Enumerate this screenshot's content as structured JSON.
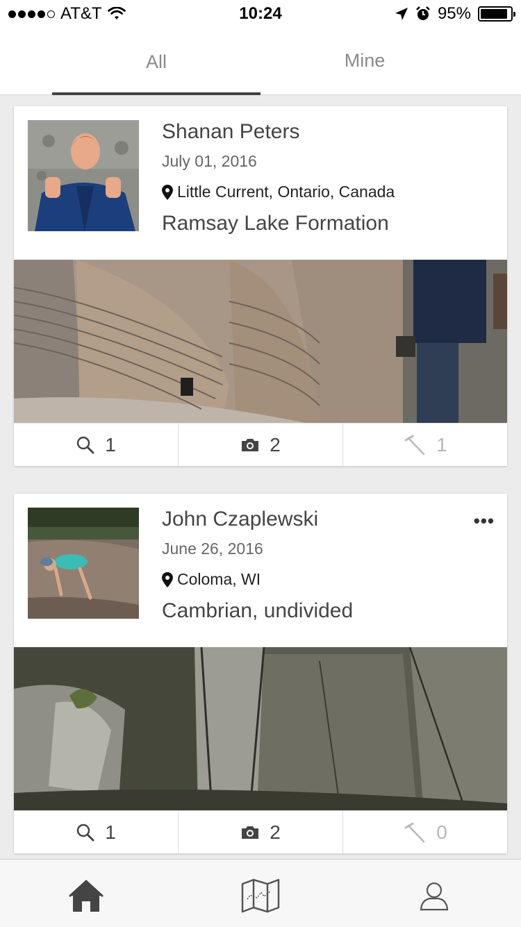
{
  "status_bar": {
    "carrier": "AT&T",
    "time": "10:24",
    "battery": "95%",
    "battery_level": 0.95,
    "signal_bars": 4,
    "signal_total": 5
  },
  "tabs": [
    {
      "label": "All",
      "selected": true
    },
    {
      "label": "Mine",
      "selected": false
    }
  ],
  "posts": [
    {
      "name": "Shanan Peters",
      "date": "July 01, 2016",
      "location": "Little Current, Ontario, Canada",
      "unit": "Ramsay Lake Formation",
      "show_more": false,
      "counts": {
        "observations": "1",
        "photos": "2",
        "fossils": "1"
      }
    },
    {
      "name": "John Czaplewski",
      "date": "June 26, 2016",
      "location": "Coloma, WI",
      "unit": "Cambrian, undivided",
      "show_more": true,
      "more_label": "•••",
      "counts": {
        "observations": "1",
        "photos": "2",
        "fossils": "0"
      }
    }
  ],
  "nav": [
    {
      "icon": "home-icon",
      "active": true
    },
    {
      "icon": "map-icon",
      "active": false
    },
    {
      "icon": "profile-icon",
      "active": false
    }
  ],
  "colors": {
    "tab_underline": "#444444",
    "disabled_icon": "#b8b8b8",
    "card_bg": "#ffffff",
    "page_bg": "#ececec"
  }
}
